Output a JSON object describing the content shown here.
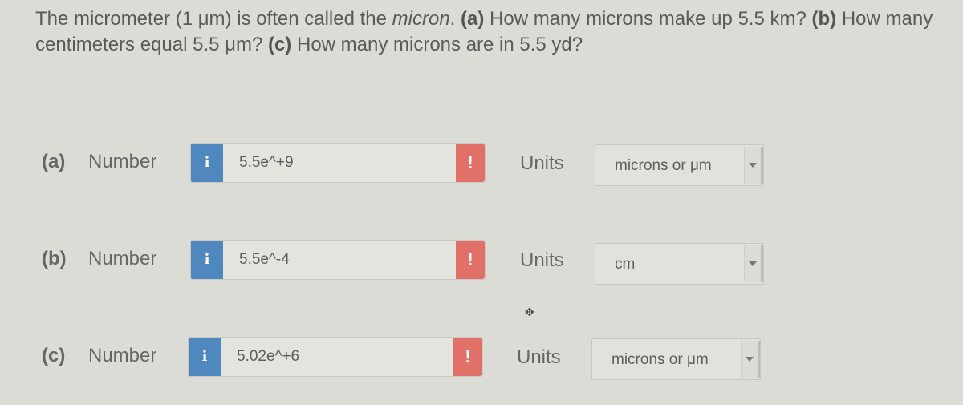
{
  "question": {
    "s1": "The micrometer (1 μm) is often called the ",
    "s1_italic": "micron",
    "s2": ". ",
    "a_label": "(a)",
    "a_text": " How many microns make up 5.5 km? ",
    "b_label": "(b)",
    "b_text": " How many centimeters equal 5.5 μm? ",
    "c_label": "(c)",
    "c_text": " How many microns are in 5.5 yd?"
  },
  "rows": [
    {
      "part": "(a)",
      "number_label": "Number",
      "value": "5.5e^+9",
      "units_label": "Units",
      "unit": "microns or μm"
    },
    {
      "part": "(b)",
      "number_label": "Number",
      "value": "5.5e^-4",
      "units_label": "Units",
      "unit": "cm"
    },
    {
      "part": "(c)",
      "number_label": "Number",
      "value": "5.02e^+6",
      "units_label": "Units",
      "unit": "microns or μm"
    }
  ],
  "icons": {
    "info": "i",
    "warning": "!"
  },
  "colors": {
    "info": "#4f88be",
    "warning": "#e07068"
  }
}
